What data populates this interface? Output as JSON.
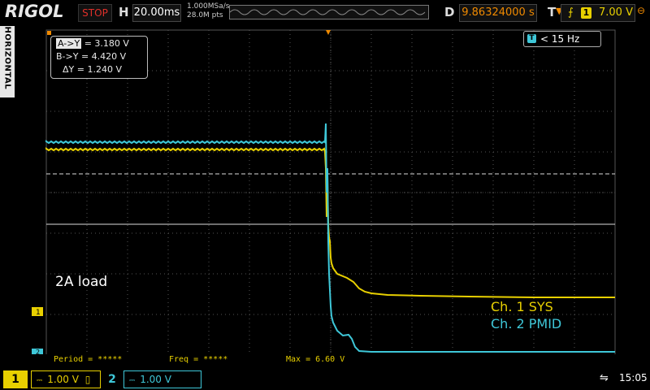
{
  "brand": "RIGOL",
  "header": {
    "run_state": "STOP",
    "h_label": "H",
    "timebase": "20.00ms",
    "sample_rate": "1.000MSa/s",
    "memory_depth": "28.0M pts",
    "d_label": "D",
    "trigger_position": "9.86324000 s",
    "t_label": "T",
    "trigger_source": "1",
    "trigger_level": "7.00 V"
  },
  "side_tab": "HORIZONTAL",
  "cursor_box": {
    "a_label": "A->Y",
    "a_value": "= 3.180 V",
    "b_label": "B->Y",
    "b_value": "= 4.420 V",
    "delta_label": "ΔY",
    "delta_value": "= 1.240 V"
  },
  "freq_box": {
    "icon_label": "T",
    "text": "< 15 Hz"
  },
  "annotation": "2A load",
  "channel_labels": {
    "ch1": "Ch. 1 SYS",
    "ch2": "Ch. 2 PMID"
  },
  "channel_markers": {
    "ch1": "1",
    "ch2": "2"
  },
  "measurements": {
    "period": "Period = *****",
    "freq": "Freq = *****",
    "max": "Max = 6.60 V"
  },
  "bottom": {
    "ch1_tag": "1",
    "ch1_scale": "1.00 V",
    "ch2_tag": "2",
    "ch2_scale": "1.00 V",
    "time": "15:05"
  },
  "colors": {
    "ch1": "#e8d000",
    "ch2": "#3ec7d8",
    "accent": "#f08a00",
    "stop": "#e0302a"
  }
}
